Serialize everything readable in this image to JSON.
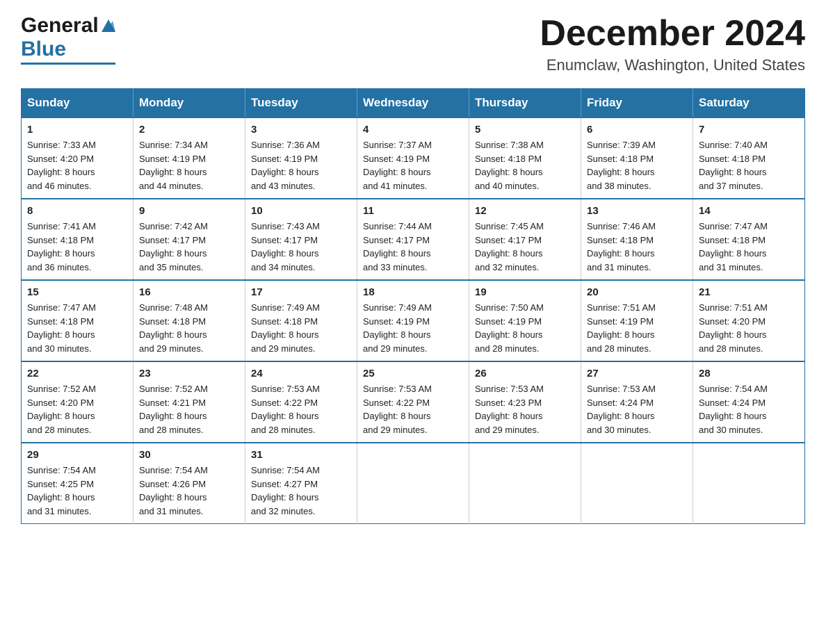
{
  "logo": {
    "general": "General",
    "blue": "Blue"
  },
  "title": {
    "month_year": "December 2024",
    "location": "Enumclaw, Washington, United States"
  },
  "weekdays": [
    "Sunday",
    "Monday",
    "Tuesday",
    "Wednesday",
    "Thursday",
    "Friday",
    "Saturday"
  ],
  "weeks": [
    [
      {
        "day": "1",
        "sunrise": "7:33 AM",
        "sunset": "4:20 PM",
        "daylight": "8 hours and 46 minutes."
      },
      {
        "day": "2",
        "sunrise": "7:34 AM",
        "sunset": "4:19 PM",
        "daylight": "8 hours and 44 minutes."
      },
      {
        "day": "3",
        "sunrise": "7:36 AM",
        "sunset": "4:19 PM",
        "daylight": "8 hours and 43 minutes."
      },
      {
        "day": "4",
        "sunrise": "7:37 AM",
        "sunset": "4:19 PM",
        "daylight": "8 hours and 41 minutes."
      },
      {
        "day": "5",
        "sunrise": "7:38 AM",
        "sunset": "4:18 PM",
        "daylight": "8 hours and 40 minutes."
      },
      {
        "day": "6",
        "sunrise": "7:39 AM",
        "sunset": "4:18 PM",
        "daylight": "8 hours and 38 minutes."
      },
      {
        "day": "7",
        "sunrise": "7:40 AM",
        "sunset": "4:18 PM",
        "daylight": "8 hours and 37 minutes."
      }
    ],
    [
      {
        "day": "8",
        "sunrise": "7:41 AM",
        "sunset": "4:18 PM",
        "daylight": "8 hours and 36 minutes."
      },
      {
        "day": "9",
        "sunrise": "7:42 AM",
        "sunset": "4:17 PM",
        "daylight": "8 hours and 35 minutes."
      },
      {
        "day": "10",
        "sunrise": "7:43 AM",
        "sunset": "4:17 PM",
        "daylight": "8 hours and 34 minutes."
      },
      {
        "day": "11",
        "sunrise": "7:44 AM",
        "sunset": "4:17 PM",
        "daylight": "8 hours and 33 minutes."
      },
      {
        "day": "12",
        "sunrise": "7:45 AM",
        "sunset": "4:17 PM",
        "daylight": "8 hours and 32 minutes."
      },
      {
        "day": "13",
        "sunrise": "7:46 AM",
        "sunset": "4:18 PM",
        "daylight": "8 hours and 31 minutes."
      },
      {
        "day": "14",
        "sunrise": "7:47 AM",
        "sunset": "4:18 PM",
        "daylight": "8 hours and 31 minutes."
      }
    ],
    [
      {
        "day": "15",
        "sunrise": "7:47 AM",
        "sunset": "4:18 PM",
        "daylight": "8 hours and 30 minutes."
      },
      {
        "day": "16",
        "sunrise": "7:48 AM",
        "sunset": "4:18 PM",
        "daylight": "8 hours and 29 minutes."
      },
      {
        "day": "17",
        "sunrise": "7:49 AM",
        "sunset": "4:18 PM",
        "daylight": "8 hours and 29 minutes."
      },
      {
        "day": "18",
        "sunrise": "7:49 AM",
        "sunset": "4:19 PM",
        "daylight": "8 hours and 29 minutes."
      },
      {
        "day": "19",
        "sunrise": "7:50 AM",
        "sunset": "4:19 PM",
        "daylight": "8 hours and 28 minutes."
      },
      {
        "day": "20",
        "sunrise": "7:51 AM",
        "sunset": "4:19 PM",
        "daylight": "8 hours and 28 minutes."
      },
      {
        "day": "21",
        "sunrise": "7:51 AM",
        "sunset": "4:20 PM",
        "daylight": "8 hours and 28 minutes."
      }
    ],
    [
      {
        "day": "22",
        "sunrise": "7:52 AM",
        "sunset": "4:20 PM",
        "daylight": "8 hours and 28 minutes."
      },
      {
        "day": "23",
        "sunrise": "7:52 AM",
        "sunset": "4:21 PM",
        "daylight": "8 hours and 28 minutes."
      },
      {
        "day": "24",
        "sunrise": "7:53 AM",
        "sunset": "4:22 PM",
        "daylight": "8 hours and 28 minutes."
      },
      {
        "day": "25",
        "sunrise": "7:53 AM",
        "sunset": "4:22 PM",
        "daylight": "8 hours and 29 minutes."
      },
      {
        "day": "26",
        "sunrise": "7:53 AM",
        "sunset": "4:23 PM",
        "daylight": "8 hours and 29 minutes."
      },
      {
        "day": "27",
        "sunrise": "7:53 AM",
        "sunset": "4:24 PM",
        "daylight": "8 hours and 30 minutes."
      },
      {
        "day": "28",
        "sunrise": "7:54 AM",
        "sunset": "4:24 PM",
        "daylight": "8 hours and 30 minutes."
      }
    ],
    [
      {
        "day": "29",
        "sunrise": "7:54 AM",
        "sunset": "4:25 PM",
        "daylight": "8 hours and 31 minutes."
      },
      {
        "day": "30",
        "sunrise": "7:54 AM",
        "sunset": "4:26 PM",
        "daylight": "8 hours and 31 minutes."
      },
      {
        "day": "31",
        "sunrise": "7:54 AM",
        "sunset": "4:27 PM",
        "daylight": "8 hours and 32 minutes."
      },
      null,
      null,
      null,
      null
    ]
  ],
  "labels": {
    "sunrise": "Sunrise:",
    "sunset": "Sunset:",
    "daylight": "Daylight:"
  }
}
